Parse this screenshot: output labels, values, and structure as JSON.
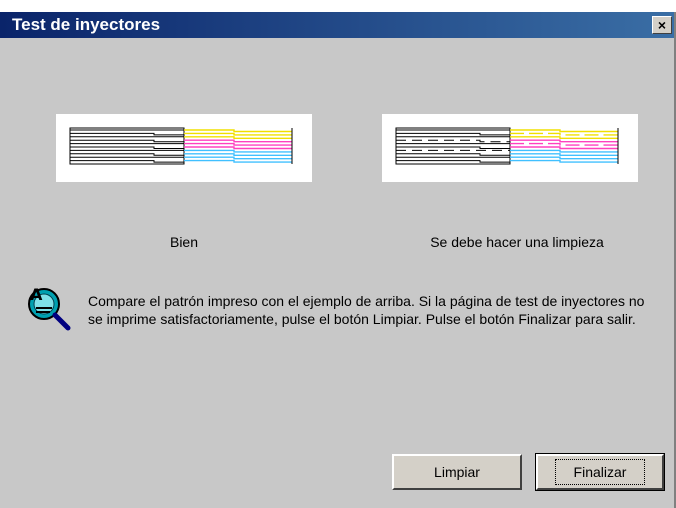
{
  "window": {
    "title": "Test de inyectores"
  },
  "titlebar": {
    "close_label": "×"
  },
  "patterns": {
    "good": {
      "caption": "Bien"
    },
    "bad": {
      "caption": "Se debe hacer una limpieza"
    }
  },
  "message": "Compare el patrón impreso con el ejemplo de arriba. Si la página de test de inyectores no se imprime satisfactoriamente, pulse el botón Limpiar. Pulse el botón Finalizar para salir.",
  "buttons": {
    "clean": "Limpiar",
    "finish": "Finalizar"
  },
  "colors": {
    "black": "#000000",
    "yellow": "#f0e000",
    "magenta": "#ff40c0",
    "cyan": "#40c0ff"
  },
  "icons": {
    "info": "magnifier-info-icon"
  }
}
